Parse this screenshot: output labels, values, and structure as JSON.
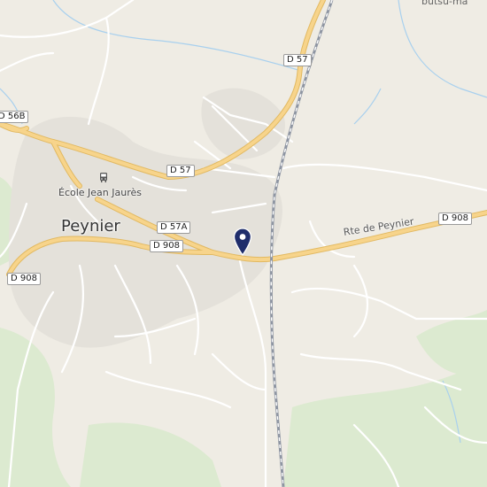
{
  "map": {
    "town_label": "Peynier",
    "poi_label": "École Jean Jaurès",
    "road_name": "Rte de Peynier",
    "corner_label": "butsu-ma",
    "road_shields": [
      {
        "id": "d57-top",
        "text": "D 57"
      },
      {
        "id": "d56b",
        "text": "D 56B"
      },
      {
        "id": "d57-mid",
        "text": "D 57"
      },
      {
        "id": "d57a",
        "text": "D 57A"
      },
      {
        "id": "d908-center",
        "text": "D 908"
      },
      {
        "id": "d908-east",
        "text": "D 908"
      },
      {
        "id": "d908-west",
        "text": "D 908"
      }
    ],
    "icons": {
      "bus_stop": "bus-icon",
      "location_marker": "map-pin-icon"
    },
    "colors": {
      "land": "#efece4",
      "urban": "#e4e1da",
      "forest": "#dcead0",
      "major_road": "#f7d48b",
      "minor_road": "#ffffff",
      "railway": "#8e95a2",
      "water": "#a8d0ee",
      "pin": "#1f2d6b"
    }
  }
}
